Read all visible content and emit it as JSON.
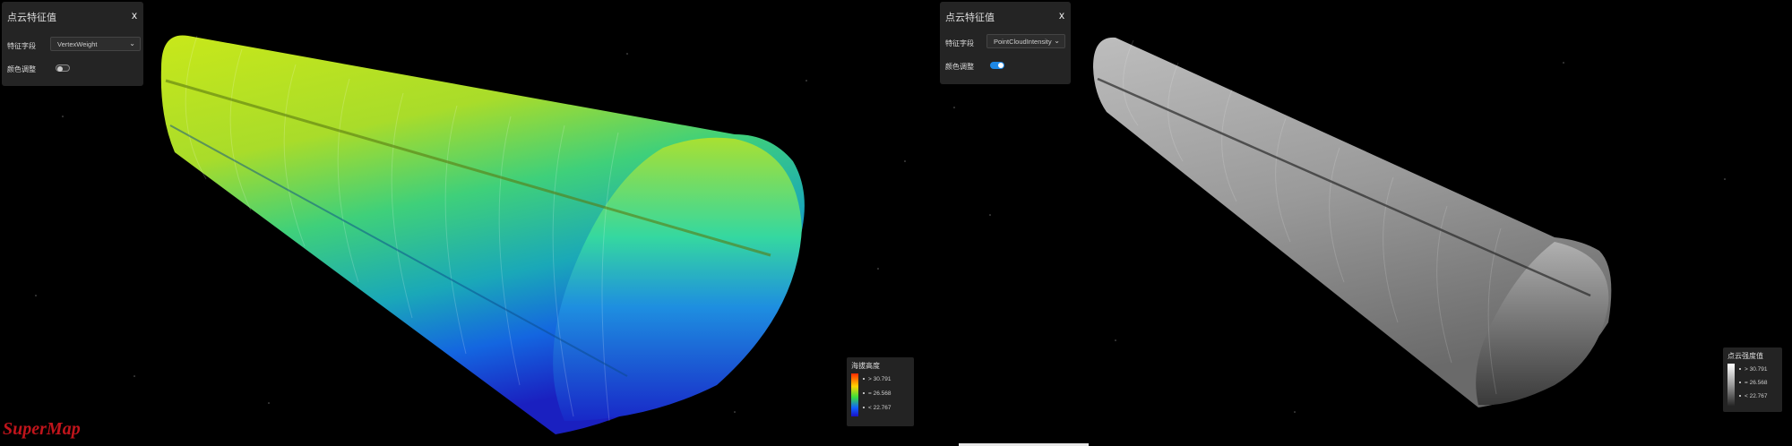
{
  "left_panel": {
    "title": "点云特征值",
    "close": "x",
    "field_label": "特征字段",
    "field_value": "VertexWeight",
    "color_label": "颜色调整",
    "toggle_on": false
  },
  "right_panel": {
    "title": "点云特征值",
    "close": "x",
    "field_label": "特征字段",
    "field_value": "PointCloudIntensity",
    "color_label": "颜色调整",
    "toggle_on": true
  },
  "left_legend": {
    "title": "海拔高度",
    "ticks": [
      "> 30.791",
      "= 26.568",
      "< 22.767"
    ],
    "gradient_colors": [
      "#ff2a00",
      "#ffd400",
      "#3ae03a",
      "#1060ff",
      "#1a10c8"
    ]
  },
  "right_legend": {
    "title": "点云强度值",
    "ticks": [
      "> 30.791",
      "= 26.568",
      "< 22.767"
    ],
    "gradient_colors": [
      "#ffffff",
      "#9a9a9a",
      "#222222"
    ]
  },
  "logo_text": "SuperMap",
  "colors": {
    "accent_toggle": "#1e88e5",
    "background": "#000000",
    "panel": "#282828"
  }
}
